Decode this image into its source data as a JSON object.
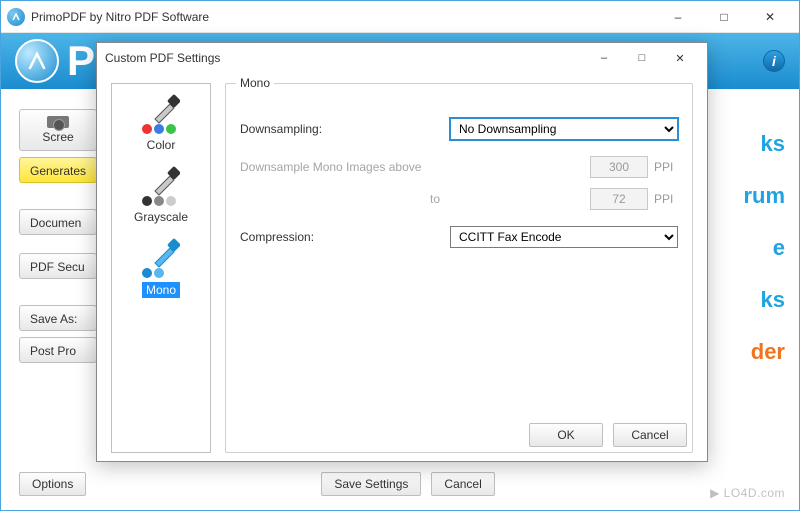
{
  "main": {
    "title": "PrimoPDF by Nitro PDF Software",
    "brand_initial": "P",
    "buttons": {
      "screen": "Scree",
      "generates": "Generates",
      "document": "Documen",
      "pdfsec": "PDF Secu",
      "saveas": "Save As:",
      "postproc": "Post Pro",
      "options": "Options",
      "save_settings": "Save Settings",
      "cancel": "Cancel"
    },
    "rside": {
      "ks": "ks",
      "rum": "rum",
      "e": "e",
      "ks2": "ks",
      "der": "der"
    }
  },
  "dialog": {
    "title": "Custom PDF Settings",
    "sidebar": {
      "color": "Color",
      "grayscale": "Grayscale",
      "mono": "Mono"
    },
    "group": {
      "title": "Mono",
      "downsampling_label": "Downsampling:",
      "downsampling_value": "No Downsampling",
      "above_label": "Downsample Mono Images above",
      "above_value": "300",
      "to_label": "to",
      "to_value": "72",
      "ppi": "PPI",
      "compression_label": "Compression:",
      "compression_value": "CCITT Fax Encode"
    },
    "buttons": {
      "ok": "OK",
      "cancel": "Cancel"
    }
  },
  "watermark": "▶ LO4D.com"
}
